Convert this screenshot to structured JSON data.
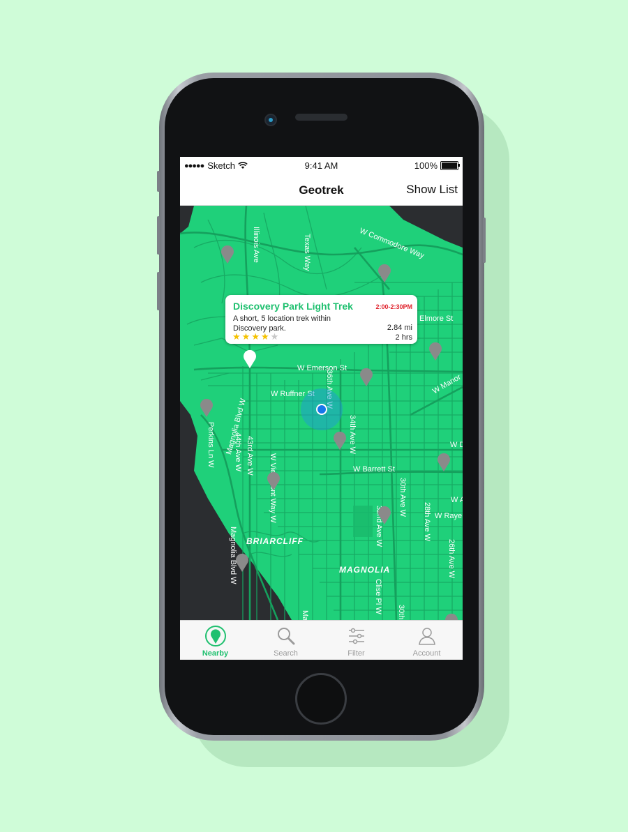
{
  "status_bar": {
    "carrier": "Sketch",
    "time": "9:41 AM",
    "battery": "100%"
  },
  "nav": {
    "title": "Geotrek",
    "action_label": "Show List"
  },
  "map": {
    "streets": {
      "illinois": "Illinois Ave",
      "texas": "Texas Way",
      "commodore": "W Commodore Way",
      "elmore": "Elmore St",
      "emerson": "W Emerson St",
      "ruffner": "W Ruffner St",
      "thirty_sixth": "36th Ave W",
      "thirty_fourth": "34th Ave W",
      "manor": "W Manor",
      "magnolia_blvd": "Magnolia Blvd W",
      "perkins": "Perkins Ln W",
      "forty_fourth": "44th Ave W",
      "forty_third": "43rd Ave W",
      "viewmont": "W Viewmont Way W",
      "barrett": "W Barrett St",
      "thirtieth": "30th Ave W",
      "thirty_second": "32nd Ave W",
      "twenty_eighth": "28th Ave W",
      "raye": "W Raye",
      "twenty_sixth": "26th Ave W",
      "w_d": "W D",
      "w_a": "W A",
      "magnolia_blvd_2": "Magnolia Blvd W",
      "clise": "Clise Pl W",
      "thirtieth_2": "30th",
      "magnolia_lower": "Ma"
    },
    "neighborhoods": {
      "briarcliff": "BRIARCLIFF",
      "magnolia": "MAGNOLIA"
    },
    "callout": {
      "title": "Discovery Park Light Trek",
      "time": "2:00-2:30PM",
      "description": "A short, 5 location trek within Discovery park.",
      "distance": "2.84 mi",
      "duration": "2 hrs",
      "rating": 4,
      "rating_max": 5
    }
  },
  "tabs": [
    {
      "label": "Nearby",
      "icon": "map-pin-icon",
      "active": true
    },
    {
      "label": "Search",
      "icon": "search-icon",
      "active": false
    },
    {
      "label": "Filter",
      "icon": "sliders-icon",
      "active": false
    },
    {
      "label": "Account",
      "icon": "user-icon",
      "active": false
    }
  ],
  "colors": {
    "background": "#cffcd8",
    "map_green": "#1fd07a",
    "accent": "#1fc06f",
    "water": "#2b2d30",
    "time_red": "#e0242e"
  }
}
